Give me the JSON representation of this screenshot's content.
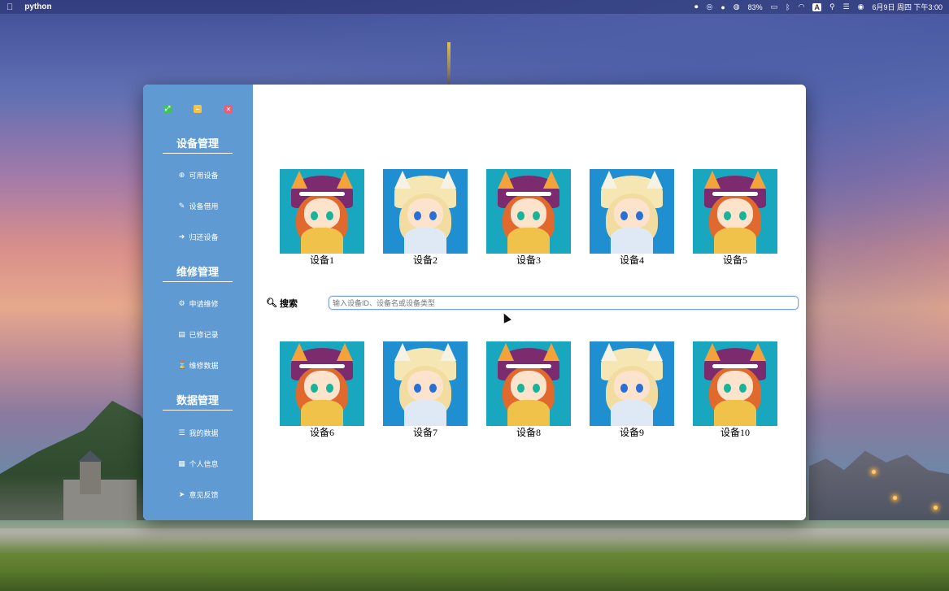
{
  "menubar": {
    "app_name": "python",
    "battery": "83%",
    "datetime": "6月9日 周四 下午3:00"
  },
  "sidebar": {
    "sections": [
      {
        "title": "设备管理",
        "items": [
          {
            "label": "可用设备",
            "icon": "plus-circle-icon"
          },
          {
            "label": "设备借用",
            "icon": "edit-icon"
          },
          {
            "label": "归还设备",
            "icon": "arrow-circle-icon"
          }
        ]
      },
      {
        "title": "维修管理",
        "items": [
          {
            "label": "申请维修",
            "icon": "gears-icon"
          },
          {
            "label": "已修记录",
            "icon": "file-icon"
          },
          {
            "label": "维修数据",
            "icon": "hourglass-icon"
          }
        ]
      },
      {
        "title": "数据管理",
        "items": [
          {
            "label": "我的数据",
            "icon": "list-icon"
          },
          {
            "label": "个人信息",
            "icon": "map-icon"
          },
          {
            "label": "意见反馈",
            "icon": "paper-plane-icon"
          }
        ]
      }
    ]
  },
  "devices_top": [
    {
      "label": "设备1",
      "image": "girl"
    },
    {
      "label": "设备2",
      "image": "boy"
    },
    {
      "label": "设备3",
      "image": "girl"
    },
    {
      "label": "设备4",
      "image": "boy"
    },
    {
      "label": "设备5",
      "image": "girl"
    }
  ],
  "search": {
    "label": "搜索",
    "placeholder": "输入设备ID、设备名或设备类型",
    "value": ""
  },
  "devices_bottom": [
    {
      "label": "设备6",
      "image": "girl"
    },
    {
      "label": "设备7",
      "image": "boy"
    },
    {
      "label": "设备8",
      "image": "girl"
    },
    {
      "label": "设备9",
      "image": "boy"
    },
    {
      "label": "设备10",
      "image": "girl"
    }
  ]
}
